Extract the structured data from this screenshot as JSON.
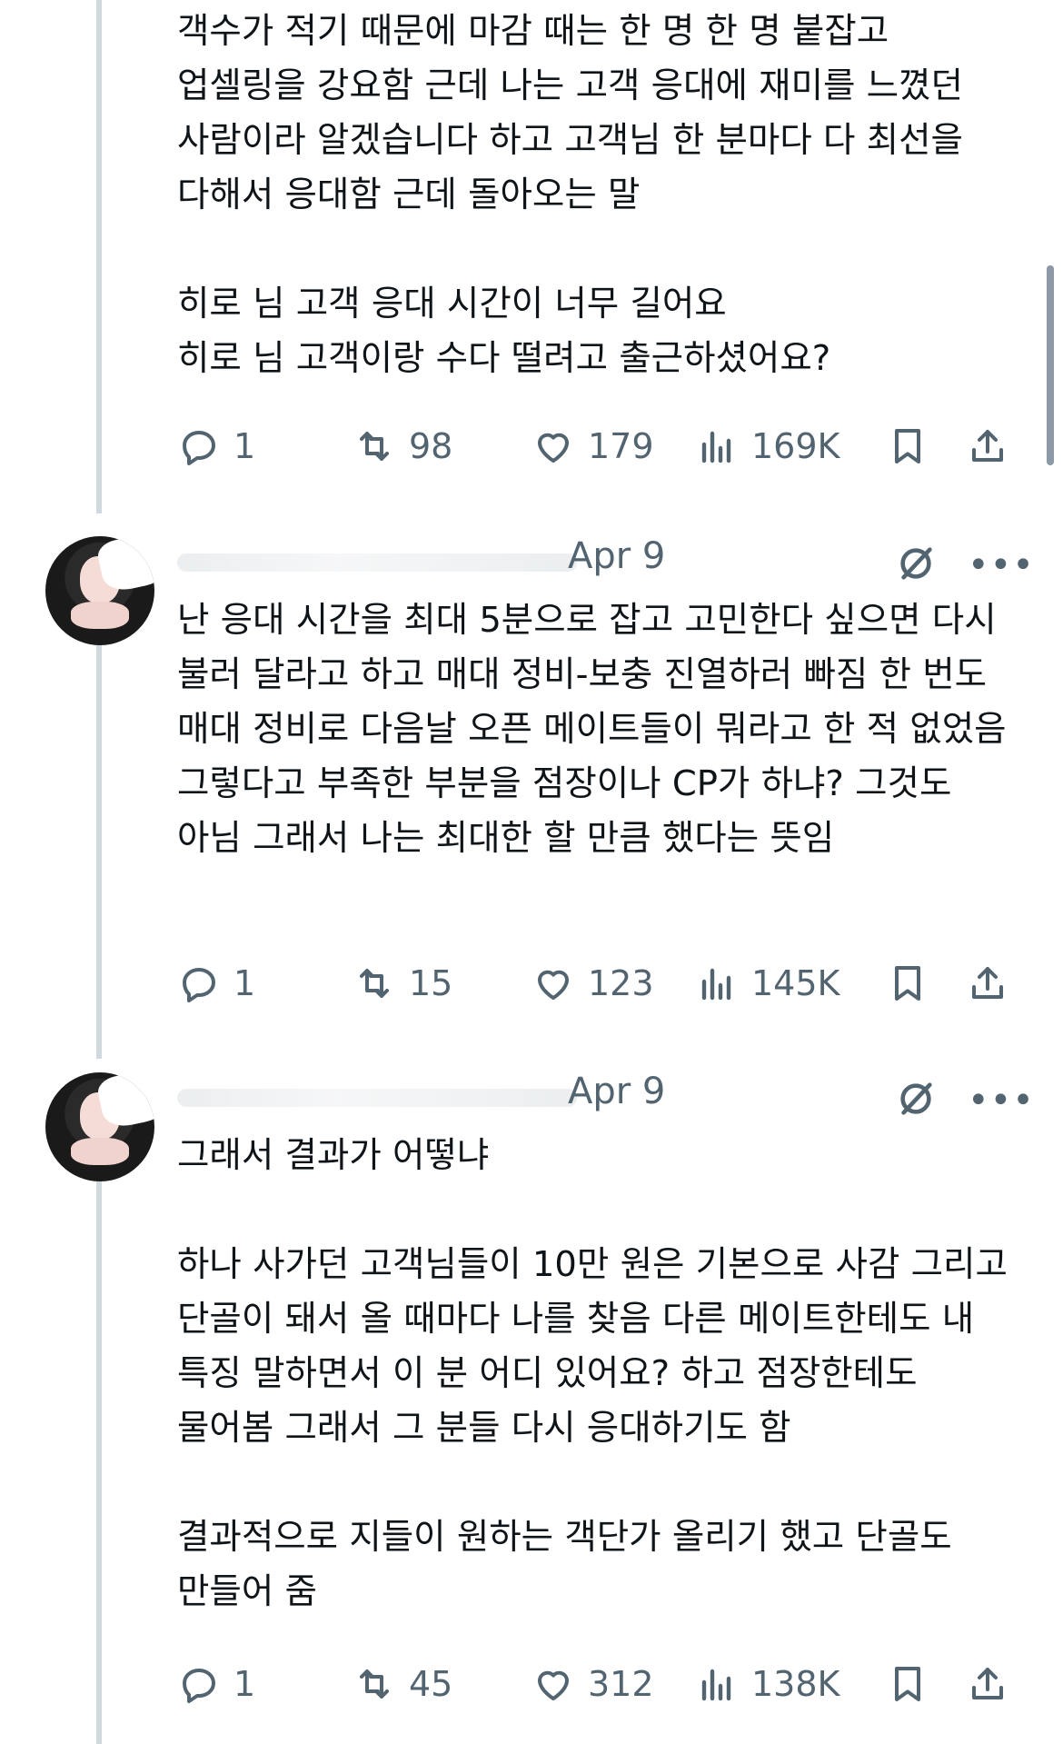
{
  "tweets": [
    {
      "body": "객수가 적기 때문에 마감 때는 한 명 한 명 붙잡고 업셀링을 강요함 근데 나는 고객 응대에 재미를 느꼈던 사람이라 알겠습니다 하고 고객님 한 분마다 다 최선을 다해서 응대함 근데 돌아오는 말\n\n히로 님 고객 응대 시간이 너무 길어요\n히로 님 고객이랑 수다 떨려고 출근하셨어요?",
      "replies": "1",
      "reposts": "98",
      "likes": "179",
      "views": "169K"
    },
    {
      "date": "Apr 9",
      "body": "난 응대 시간을 최대 5분으로 잡고 고민한다 싶으면 다시 불러 달라고 하고 매대 정비-보충 진열하러 빠짐 한 번도 매대 정비로 다음날 오픈 메이트들이 뭐라고 한 적 없었음 그렇다고 부족한 부분을 점장이나 CP가 하냐? 그것도 아님 그래서 나는 최대한 할 만큼 했다는 뜻임",
      "replies": "1",
      "reposts": "15",
      "likes": "123",
      "views": "145K"
    },
    {
      "date": "Apr 9",
      "body": "그래서 결과가 어떻냐\n\n하나 사가던 고객님들이 10만 원은 기본으로 사감 그리고 단골이 돼서 올 때마다 나를 찾음 다른 메이트한테도 내 특징 말하면서 이 분 어디 있어요? 하고 점장한테도 물어봄 그래서 그 분들 다시 응대하기도 함\n\n결과적으로 지들이 원하는 객단가 올리기 했고 단골도 만들어 줌",
      "replies": "1",
      "reposts": "45",
      "likes": "312",
      "views": "138K"
    }
  ],
  "icons": {
    "reply": "reply-icon",
    "repost": "repost-icon",
    "like": "heart-icon",
    "views": "views-icon",
    "bookmark": "bookmark-icon",
    "share": "share-icon",
    "grok": "grok-icon",
    "more": "more-icon"
  },
  "colors": {
    "text": "#0f1419",
    "secondary": "#536471",
    "thread_line": "#cfd9de"
  }
}
